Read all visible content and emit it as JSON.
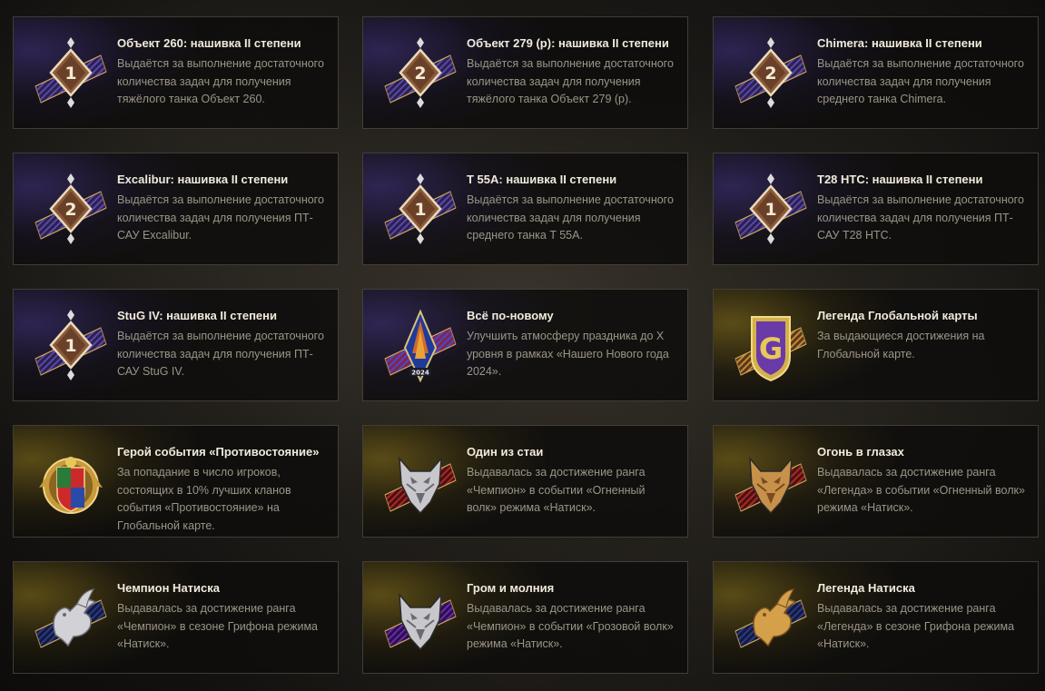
{
  "cards": [
    {
      "title": "Объект 260: нашивка II степени",
      "desc": "Выдаётся за выполнение достаточного количества задач для получения тяжёлого танка Объект 260.",
      "icon": "stripe-badge-icon",
      "glyph": "1",
      "theme": "purple"
    },
    {
      "title": "Объект 279 (р): нашивка II степени",
      "desc": "Выдаётся за выполнение достаточного количества задач для получения тяжёлого танка Объект 279 (р).",
      "icon": "stripe-badge-icon",
      "glyph": "2",
      "theme": "purple"
    },
    {
      "title": "Chimera: нашивка II степени",
      "desc": "Выдаётся за выполнение достаточного количества задач для получения среднего танка Chimera.",
      "icon": "stripe-badge-icon",
      "glyph": "2",
      "theme": "purple"
    },
    {
      "title": "Excalibur: нашивка II степени",
      "desc": "Выдаётся за выполнение достаточного количества задач для получения ПТ-САУ Excalibur.",
      "icon": "stripe-badge-icon",
      "glyph": "2",
      "theme": "purple"
    },
    {
      "title": "T 55A: нашивка II степени",
      "desc": "Выдаётся за выполнение достаточного количества задач для получения среднего танка T 55A.",
      "icon": "stripe-badge-icon",
      "glyph": "1",
      "theme": "purple"
    },
    {
      "title": "T28 HTC: нашивка II степени",
      "desc": "Выдаётся за выполнение достаточного количества задач для получения ПТ-САУ T28 HTC.",
      "icon": "stripe-badge-icon",
      "glyph": "1",
      "theme": "purple"
    },
    {
      "title": "StuG IV: нашивка II степени",
      "desc": "Выдаётся за выполнение достаточного количества задач для получения ПТ-САУ StuG IV.",
      "icon": "stripe-badge-icon",
      "glyph": "1",
      "theme": "purple"
    },
    {
      "title": "Всё по-новому",
      "desc": "Улучшить атмосферу праздника до X уровня в рамках «Нашего Нового года 2024».",
      "icon": "new-year-tree-badge-icon",
      "glyph": "2024",
      "theme": "purple"
    },
    {
      "title": "Легенда Глобальной карты",
      "desc": "За выдающиеся достижения на Глобальной карте.",
      "icon": "global-map-shield-icon",
      "glyph": "G",
      "theme": "gold"
    },
    {
      "title": "Герой события «Противостояние»",
      "desc": "За попадание в число игроков, состоящих в 10% лучших кланов события «Противостояние» на Глобальной карте.",
      "icon": "clan-crest-medal-icon",
      "glyph": "",
      "theme": "gold"
    },
    {
      "title": "Один из стаи",
      "desc": "Выдавалась за достижение ранга «Чемпион» в событии «Огненный волк» режима «Натиск».",
      "icon": "silver-wolf-badge-icon",
      "glyph": "",
      "theme": "gold"
    },
    {
      "title": "Огонь в глазах",
      "desc": "Выдавалась за достижение ранга «Легенда» в событии «Огненный волк» режима «Натиск».",
      "icon": "gold-wolf-badge-icon",
      "glyph": "",
      "theme": "gold"
    },
    {
      "title": "Чемпион Натиска",
      "desc": "Выдавалась за достижение ранга «Чемпион» в сезоне Грифона режима «Натиск».",
      "icon": "silver-griffin-badge-icon",
      "glyph": "",
      "theme": "gold"
    },
    {
      "title": "Гром и молния",
      "desc": "Выдавалась за достижение ранга «Чемпион» в событии «Грозовой волк» режима «Натиск».",
      "icon": "storm-wolf-badge-icon",
      "glyph": "",
      "theme": "gold"
    },
    {
      "title": "Легенда Натиска",
      "desc": "Выдавалась за достижение ранга «Легенда» в сезоне Грифона режима «Натиск».",
      "icon": "gold-griffin-badge-icon",
      "glyph": "",
      "theme": "gold"
    }
  ],
  "colors": {
    "purple_glow": "#46378c",
    "gold_glow": "#967d1e",
    "title": "#f1ebdc",
    "description": "#9b9588",
    "badge_copper": "#8a5a3a"
  }
}
